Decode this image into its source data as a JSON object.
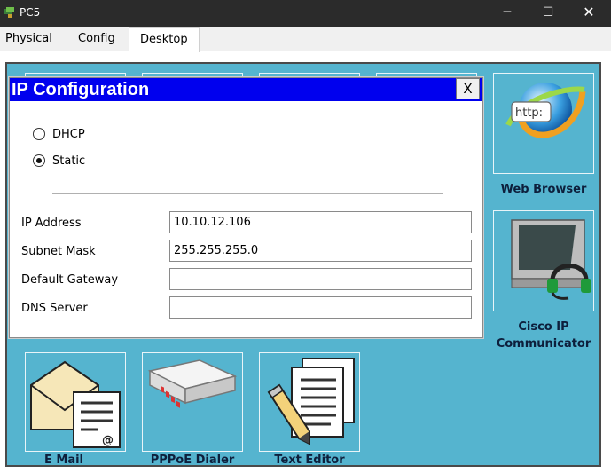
{
  "window": {
    "title": "PC5",
    "minimize": "─",
    "maximize": "☐",
    "close": "✕"
  },
  "tabs": [
    {
      "label": "Physical"
    },
    {
      "label": "Config"
    },
    {
      "label": "Desktop",
      "active": true
    }
  ],
  "dialog": {
    "title": "IP Configuration",
    "close_label": "X",
    "mode_options": [
      {
        "label": "DHCP",
        "selected": false
      },
      {
        "label": "Static",
        "selected": true
      }
    ],
    "fields": [
      {
        "label": "IP Address",
        "value": "10.10.12.106"
      },
      {
        "label": "Subnet Mask",
        "value": "255.255.255.0"
      },
      {
        "label": "Default Gateway",
        "value": ""
      },
      {
        "label": "DNS Server",
        "value": ""
      }
    ]
  },
  "desktop_apps": [
    {
      "label": "Web Browser",
      "icon": "web-browser-icon"
    },
    {
      "label": "Cisco IP Communicator",
      "line1": "Cisco IP",
      "line2": "Communicator",
      "icon": "ip-communicator-icon"
    },
    {
      "label": "E Mail",
      "icon": "email-icon"
    },
    {
      "label": "PPPoE Dialer",
      "icon": "pppoe-dialer-icon"
    },
    {
      "label": "Text Editor",
      "icon": "text-editor-icon"
    }
  ],
  "colors": {
    "titlebar": "#2b2b2b",
    "desktop_bg": "#55b4cf",
    "dialog_title_bg": "#0000ee",
    "app_label": "#0d1f3c"
  }
}
